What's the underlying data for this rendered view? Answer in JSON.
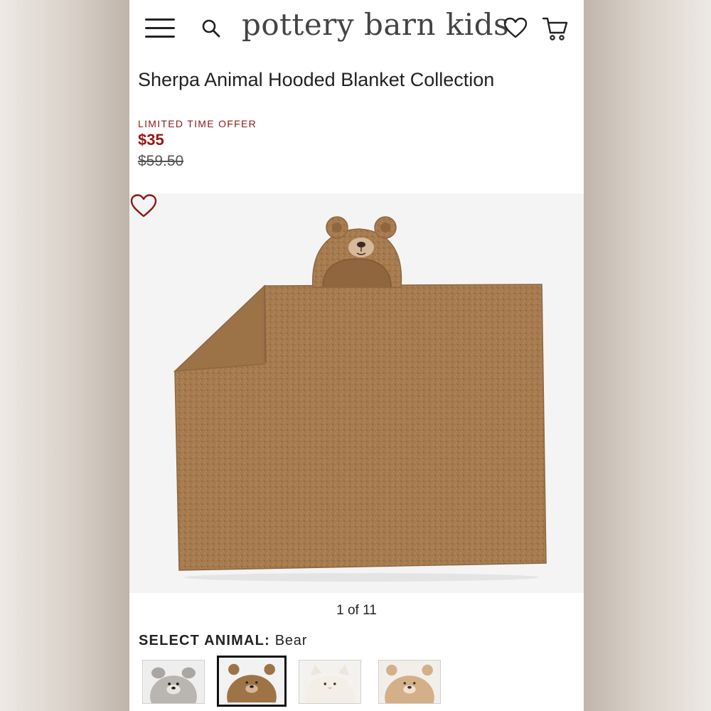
{
  "header": {
    "logo": "pottery barn kids",
    "icons": [
      "menu-icon",
      "search-icon",
      "heart-icon",
      "cart-icon"
    ]
  },
  "product": {
    "title": "Sherpa Animal Hooded Blanket Collection",
    "offer_label": "LIMITED TIME OFFER",
    "sale_price": "$35",
    "original_price": "$59.50"
  },
  "gallery": {
    "pager": "1 of 11"
  },
  "selector": {
    "label": "SELECT ANIMAL:",
    "value": "Bear",
    "options": [
      "Bunny (gray)",
      "Bear",
      "Cat",
      "Teddy (tan)"
    ]
  },
  "colors": {
    "sale_red": "#9a1414",
    "blanket_brown": "#a57a4f"
  }
}
